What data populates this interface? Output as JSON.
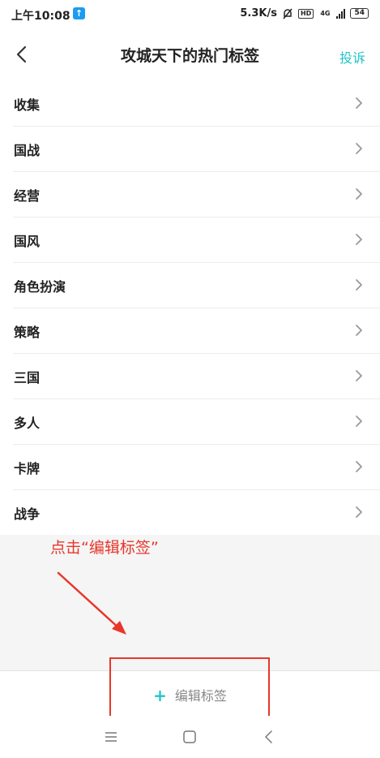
{
  "status": {
    "time": "上午10:08",
    "up_badge": "↑",
    "speed": "5.3K/s",
    "hd": "HD",
    "net": "4G",
    "battery": "54"
  },
  "nav": {
    "title": "攻城天下的热门标签",
    "report_label": "投诉"
  },
  "tags": [
    "收集",
    "国战",
    "经营",
    "国风",
    "角色扮演",
    "策略",
    "三国",
    "多人",
    "卡牌",
    "战争"
  ],
  "annotation": "点击“编辑标签”",
  "bottom": {
    "plus": "+",
    "edit_label": "编辑标签"
  },
  "colors": {
    "accent": "#21c5c7",
    "annotation": "#e8362b"
  }
}
